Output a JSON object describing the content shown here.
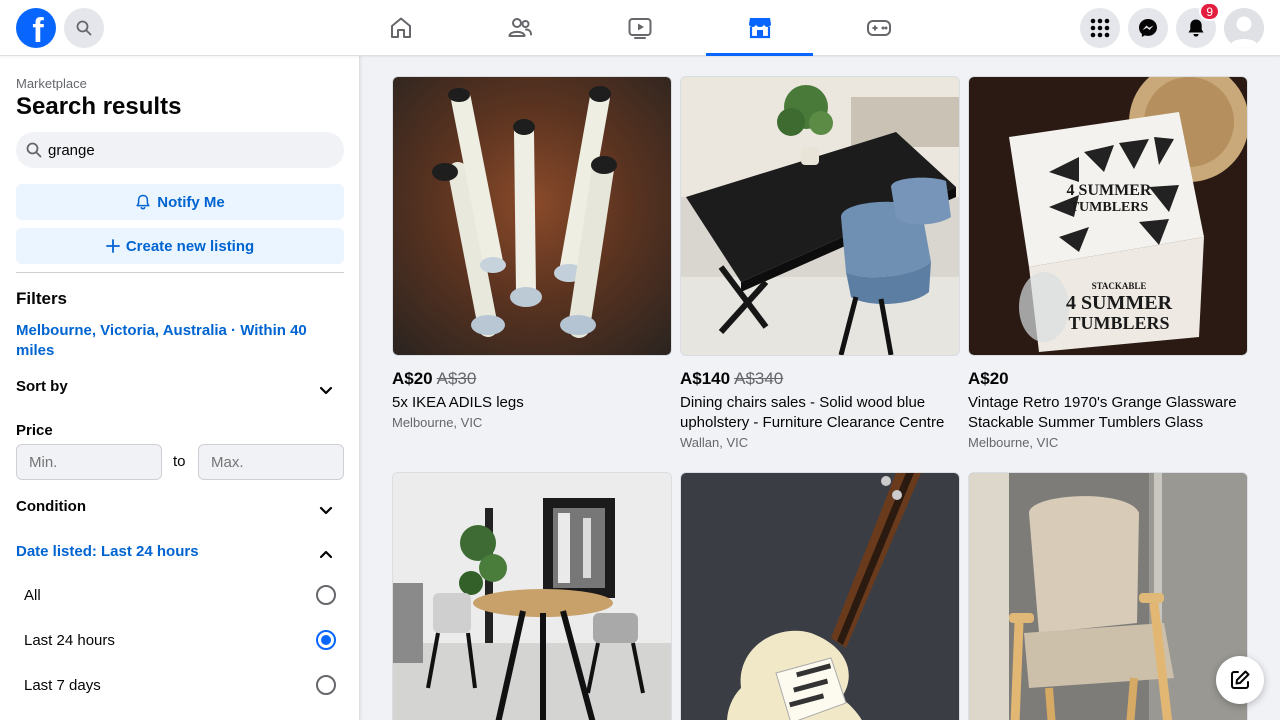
{
  "brand": {
    "logo_letter": "f",
    "color": "#0866ff"
  },
  "nav": {
    "tabs": [
      {
        "name": "home",
        "icon": "home-icon"
      },
      {
        "name": "friends",
        "icon": "friends-icon"
      },
      {
        "name": "video",
        "icon": "video-icon"
      },
      {
        "name": "marketplace",
        "icon": "marketplace-icon",
        "active": true
      },
      {
        "name": "gaming",
        "icon": "gaming-icon"
      }
    ],
    "notification_count": "9"
  },
  "sidebar": {
    "breadcrumb": "Marketplace",
    "title": "Search results",
    "search_value": "grange",
    "notify_label": "Notify Me",
    "create_label": "Create new listing",
    "filters_title": "Filters",
    "location": "Melbourne, Victoria, Australia · Within 40 miles",
    "sort_label": "Sort by",
    "price_label": "Price",
    "price_min_placeholder": "Min.",
    "price_max_placeholder": "Max.",
    "price_to": "to",
    "condition_label": "Condition",
    "date_label": "Date listed: Last 24 hours",
    "date_options": [
      {
        "label": "All",
        "checked": false
      },
      {
        "label": "Last 24 hours",
        "checked": true
      },
      {
        "label": "Last 7 days",
        "checked": false
      }
    ]
  },
  "listings": [
    {
      "price": "A$20",
      "old_price": "A$30",
      "title": "5x IKEA ADILS legs",
      "location": "Melbourne, VIC"
    },
    {
      "price": "A$140",
      "old_price": "A$340",
      "title": "Dining chairs sales - Solid wood blue upholstery - Furniture Clearance Centre",
      "location": "Wallan, VIC"
    },
    {
      "price": "A$20",
      "old_price": "",
      "title": "Vintage Retro 1970's Grange Glassware Stackable Summer Tumblers Glass",
      "location": "Melbourne, VIC"
    },
    {
      "price": "",
      "old_price": "",
      "title": "",
      "location": ""
    },
    {
      "price": "",
      "old_price": "",
      "title": "",
      "location": ""
    },
    {
      "price": "",
      "old_price": "",
      "title": "",
      "location": ""
    }
  ],
  "box_text": {
    "line1": "4 SUMMER",
    "line2": "TUMBLERS",
    "line3": "STACKABLE",
    "line4": "4 SUMMER",
    "line5": "TUMBLERS"
  }
}
